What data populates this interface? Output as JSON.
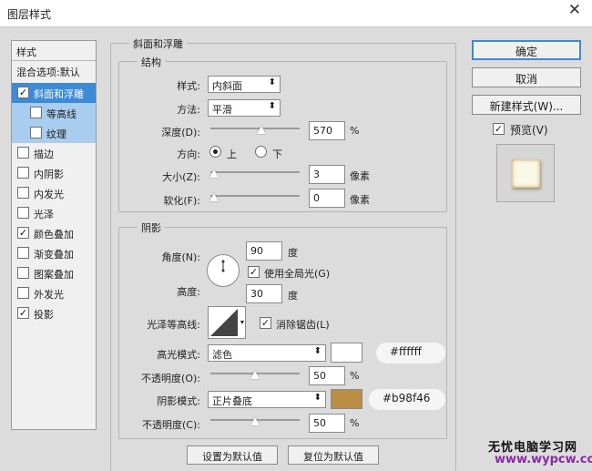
{
  "dialog": {
    "title": "图层样式",
    "close_glyph": "✕"
  },
  "left_panel": {
    "header": "样式",
    "items": [
      {
        "label": "混合选项:默认"
      },
      {
        "label": "斜面和浮雕",
        "check": "✓"
      },
      {
        "label": "等高线",
        "check": ""
      },
      {
        "label": "纹理",
        "check": ""
      },
      {
        "label": "描边",
        "check": ""
      },
      {
        "label": "内阴影",
        "check": ""
      },
      {
        "label": "内发光",
        "check": ""
      },
      {
        "label": "光泽",
        "check": ""
      },
      {
        "label": "颜色叠加",
        "check": "✓"
      },
      {
        "label": "渐变叠加",
        "check": ""
      },
      {
        "label": "图案叠加",
        "check": ""
      },
      {
        "label": "外发光",
        "check": ""
      },
      {
        "label": "投影",
        "check": "✓"
      }
    ]
  },
  "bevel": {
    "title": "斜面和浮雕",
    "structure": {
      "title": "结构",
      "style_label": "样式:",
      "style_value": "内斜面",
      "method_label": "方法:",
      "method_value": "平滑",
      "depth_label": "深度(D):",
      "depth_value": "570",
      "depth_unit": "%",
      "depth_slider": 0.57,
      "direction_label": "方向:",
      "direction_up": "上",
      "direction_down": "下",
      "size_label": "大小(Z):",
      "size_value": "3",
      "size_unit": "像素",
      "size_slider": 0.0,
      "soften_label": "软化(F):",
      "soften_value": "0",
      "soften_unit": "像素",
      "soften_slider": 0.0
    },
    "shading": {
      "title": "阴影",
      "angle_label": "角度(N):",
      "angle_value": "90",
      "angle_unit": "度",
      "global_light_label": "使用全局光(G)",
      "global_light_check": "✓",
      "altitude_label": "高度:",
      "altitude_value": "30",
      "altitude_unit": "度",
      "gloss_label": "光泽等高线:",
      "antialias_label": "消除锯齿(L)",
      "antialias_check": "✓",
      "highlight_label": "高光模式:",
      "highlight_mode": "滤色",
      "highlight_color": "#ffffff",
      "highlight_hex": "#ffffff",
      "highlight_opacity_label": "不透明度(O):",
      "highlight_opacity": "50",
      "highlight_opacity_unit": "%",
      "highlight_opacity_slider": 0.5,
      "shadow_label": "阴影模式:",
      "shadow_mode": "正片叠底",
      "shadow_color": "#b98f46",
      "shadow_hex": "#b98f46",
      "shadow_opacity_label": "不透明度(C):",
      "shadow_opacity": "50",
      "shadow_opacity_unit": "%",
      "shadow_opacity_slider": 0.5
    },
    "set_default": "设置为默认值",
    "reset_default": "复位为默认值"
  },
  "right": {
    "ok": "确定",
    "cancel": "取消",
    "new_style": "新建样式(W)...",
    "preview_label": "预览(V)",
    "preview_check": "✓"
  },
  "watermark": {
    "line1": "无忧电脑学习网",
    "line2": "www.wypcw.com"
  }
}
